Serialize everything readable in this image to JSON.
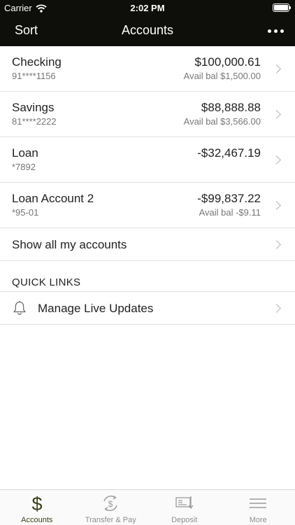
{
  "status_bar": {
    "carrier": "Carrier",
    "time": "2:02 PM"
  },
  "nav": {
    "left_label": "Sort",
    "title": "Accounts"
  },
  "accounts": [
    {
      "name": "Checking",
      "number": "91****1156",
      "balance": "$100,000.61",
      "avail": "Avail bal $1,500.00"
    },
    {
      "name": "Savings",
      "number": "81****2222",
      "balance": "$88,888.88",
      "avail": "Avail bal $3,566.00"
    },
    {
      "name": "Loan",
      "number": "*7892",
      "balance": "-$32,467.19",
      "avail": ""
    },
    {
      "name": "Loan Account 2",
      "number": "*95-01",
      "balance": "-$99,837.22",
      "avail": "Avail bal -$9.11"
    }
  ],
  "show_all_label": "Show all my accounts",
  "quick_links": {
    "header": "QUICK LINKS",
    "items": [
      {
        "label": "Manage Live Updates",
        "icon": "bell-icon"
      }
    ]
  },
  "tabs": [
    {
      "label": "Accounts",
      "icon": "dollar-icon",
      "active": true
    },
    {
      "label": "Transfer & Pay",
      "icon": "transfer-icon",
      "active": false
    },
    {
      "label": "Deposit",
      "icon": "deposit-icon",
      "active": false
    },
    {
      "label": "More",
      "icon": "menu-icon",
      "active": false
    }
  ],
  "colors": {
    "nav_bg": "#0e0f0a",
    "active_tab": "#3b3f1a",
    "inactive_tab": "#8e8e8e"
  }
}
